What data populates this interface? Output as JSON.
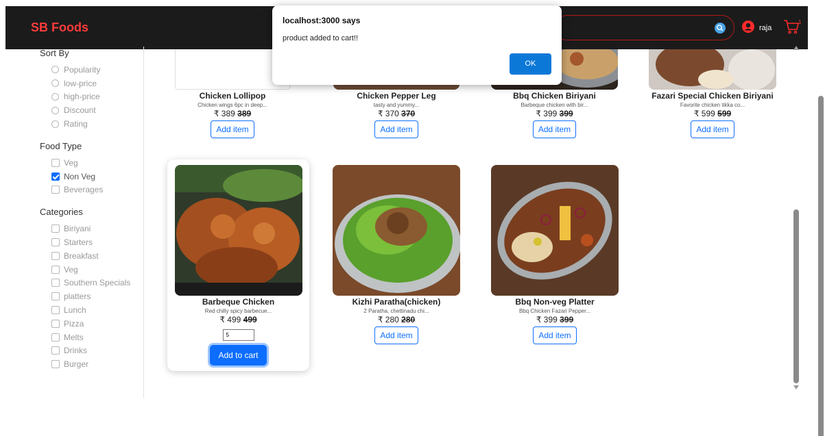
{
  "navbar": {
    "brand": "SB Foods",
    "user_name": "raja",
    "cart_count": "1"
  },
  "sidebar": {
    "sort_title": "Sort By",
    "sort_options": [
      "Popularity",
      "low-price",
      "high-price",
      "Discount",
      "Rating"
    ],
    "food_type_title": "Food Type",
    "food_types": [
      {
        "label": "Veg",
        "checked": false
      },
      {
        "label": "Non Veg",
        "checked": true
      },
      {
        "label": "Beverages",
        "checked": false
      }
    ],
    "categories_title": "Categories",
    "categories": [
      "Biriyani",
      "Starters",
      "Breakfast",
      "Veg",
      "Southern Specials",
      "platters",
      "Lunch",
      "Pizza",
      "Melts",
      "Drinks",
      "Burger"
    ]
  },
  "products_row1": [
    {
      "name": "Chicken Lollipop",
      "desc": "Chicken wings 6pc in deep...",
      "price": "₹ 389",
      "old_price": "389",
      "button": "Add item"
    },
    {
      "name": "Chicken Pepper Leg",
      "desc": "tasty and yummy...",
      "price": "₹ 370",
      "old_price": "370",
      "button": "Add item"
    },
    {
      "name": "Bbq Chicken Biriyani",
      "desc": "Barbeque chicken with bir...",
      "price": "₹ 399",
      "old_price": "399",
      "button": "Add item"
    },
    {
      "name": "Fazari Special Chicken Biriyani",
      "desc": "Favorite chicken tikka co...",
      "price": "₹ 599",
      "old_price": "599",
      "button": "Add item"
    }
  ],
  "products_row2": [
    {
      "name": "Barbeque Chicken",
      "desc": "Red chilly spicy barbecue...",
      "price": "₹ 499",
      "old_price": "499",
      "qty": "5",
      "button": "Add to cart"
    },
    {
      "name": "Kizhi Paratha(chicken)",
      "desc": "2 Paratha, chettinadu chi...",
      "price": "₹ 280",
      "old_price": "280",
      "button": "Add item"
    },
    {
      "name": "Bbq Non-veg Platter",
      "desc": "Bbq Chicken Fazari Pepper...",
      "price": "₹ 399",
      "old_price": "399",
      "button": "Add item"
    }
  ],
  "dialog": {
    "title": "localhost:3000 says",
    "message": "product added to cart!!",
    "ok_label": "OK"
  }
}
